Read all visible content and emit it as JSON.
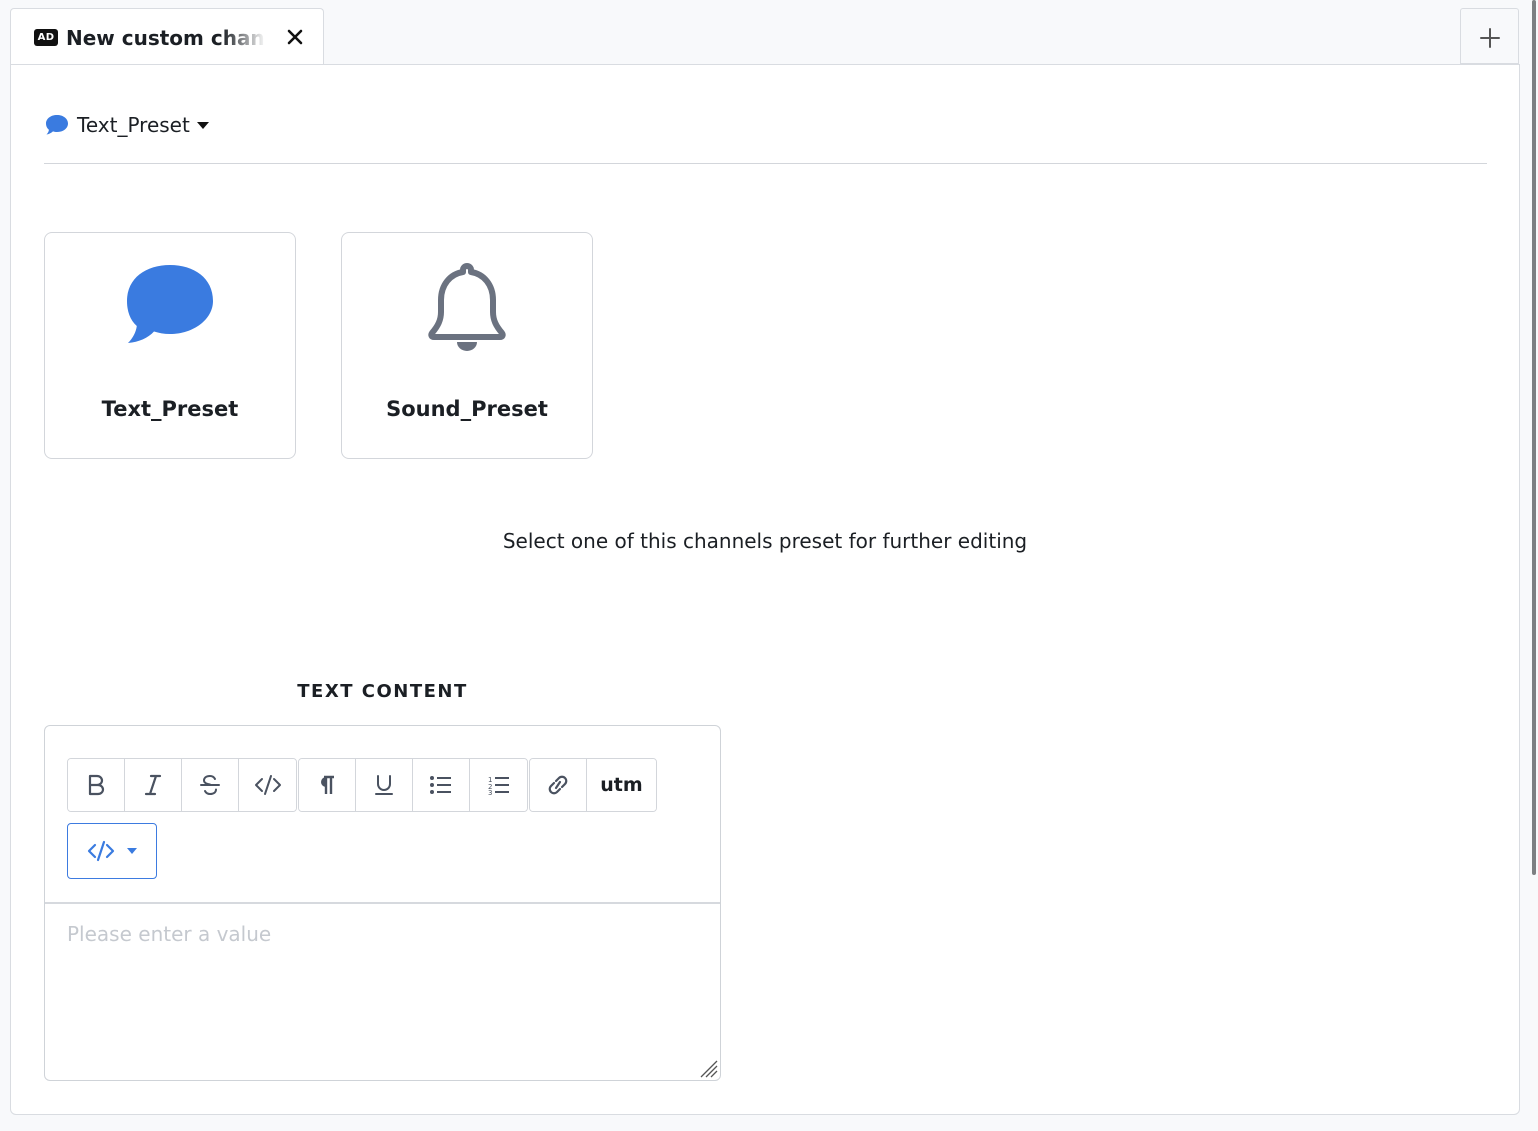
{
  "tab": {
    "badge": "AD",
    "title": "New custom channel",
    "close_icon": "close-icon",
    "add_icon": "plus-icon"
  },
  "preset_selector": {
    "icon": "chat-bubble-icon",
    "label": "Text_Preset"
  },
  "presets": [
    {
      "name": "Text_Preset",
      "icon": "chat-bubble-icon",
      "color": "#3a7be0"
    },
    {
      "name": "Sound_Preset",
      "icon": "bell-icon",
      "color": "#6b7280"
    }
  ],
  "hint": "Select one of this channels preset for further editing",
  "text_content": {
    "section_title": "TEXT CONTENT",
    "toolbar": [
      "bold",
      "italic",
      "strikethrough",
      "code",
      "paragraph",
      "underline",
      "bullet-list",
      "numbered-list",
      "link",
      "utm"
    ],
    "utm_label": "utm",
    "placeholder": "Please enter a value"
  },
  "colors": {
    "accent": "#3a7be0",
    "icon_gray": "#4a5260"
  }
}
